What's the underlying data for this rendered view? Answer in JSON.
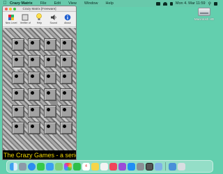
{
  "menubar": {
    "items": [
      "Crazy Matrix",
      "File",
      "Edit",
      "View",
      "Window",
      "Help"
    ],
    "clock": "Mon 4. Mar  11:59"
  },
  "desktop": {
    "drive_label": "Macintosh HD"
  },
  "window": {
    "title": "Crazy Matrix [Freeware]",
    "toolbar": [
      {
        "label": "New Level",
        "icon": "puzzle-icon"
      },
      {
        "label": "Verifier of",
        "icon": "square-icon"
      },
      {
        "label": "Help",
        "icon": "lightbulb-icon"
      },
      {
        "label": "Sound",
        "icon": "speaker-icon"
      },
      {
        "label": "About",
        "icon": "info-icon"
      }
    ],
    "grid": {
      "rows": 6,
      "cols": 4
    },
    "banner": "The Crazy Games - a series of mat"
  },
  "colors": {
    "desktop": "#63cfae",
    "banner_bg": "#000000",
    "banner_text": "#f2d700"
  },
  "dock": {
    "apps": [
      "finder",
      "launchpad",
      "safari",
      "messages",
      "mail",
      "maps",
      "photos",
      "facetime",
      "calendar",
      "notes",
      "reminders",
      "music",
      "podcasts",
      "appstore",
      "preferences",
      "crazymatrix",
      "preview",
      "downloads",
      "trash"
    ],
    "calendar_day": "4"
  }
}
